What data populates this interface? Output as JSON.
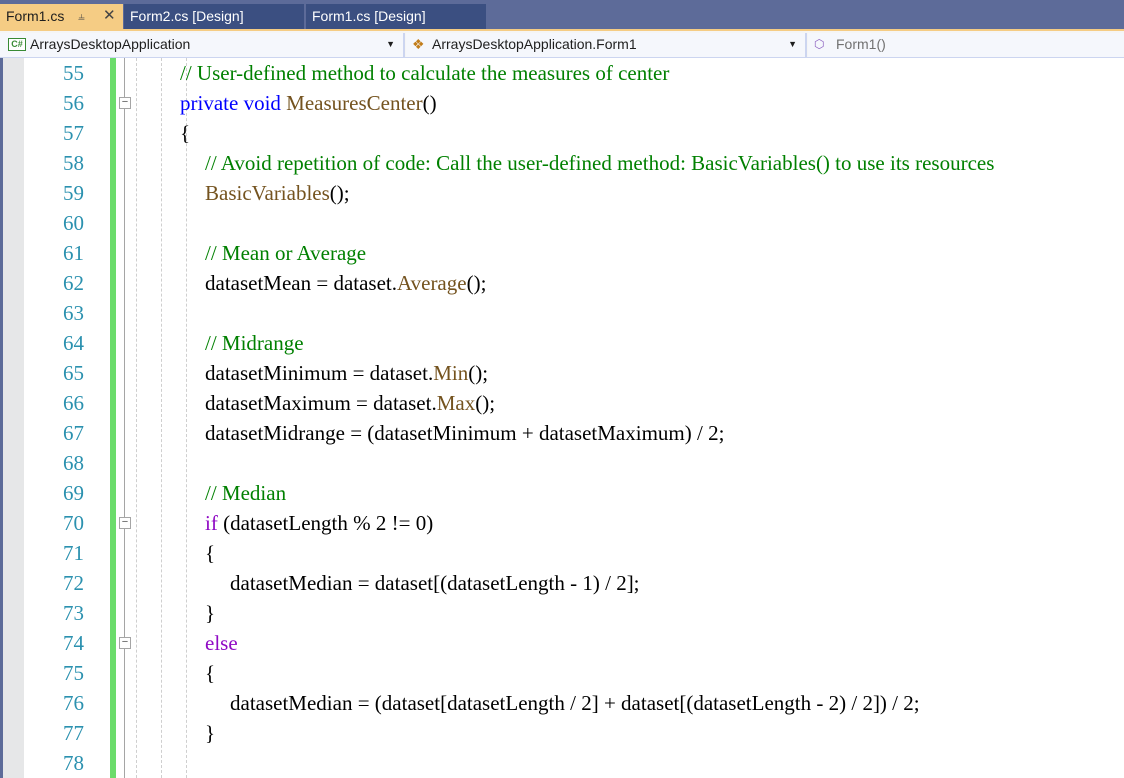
{
  "tabs": [
    {
      "label": "Form1.cs",
      "active": true,
      "pin_icon": "pin-icon",
      "close_icon": "close-icon"
    },
    {
      "label": "Form2.cs [Design]",
      "active": false
    },
    {
      "label": "Form1.cs [Design]",
      "active": false
    }
  ],
  "navbar": {
    "project": {
      "icon": "csharp-project-icon",
      "badge": "C#",
      "label": "ArraysDesktopApplication"
    },
    "type": {
      "icon": "class-icon",
      "label": "ArraysDesktopApplication.Form1"
    },
    "member": {
      "icon": "method-icon",
      "label": "Form1()"
    }
  },
  "colors": {
    "tab_bar": "#5d6b99",
    "active_tab": "#f5cc84",
    "line_number": "#2b91af",
    "keyword": "#0000ff",
    "control_keyword": "#8f08c4",
    "comment": "#008000",
    "method": "#74531f",
    "change_bar": "#6bdc6b"
  },
  "editor": {
    "lines": [
      {
        "num": "55",
        "indent": 0,
        "tokens": [
          {
            "t": "// User-defined method to calculate the measures of center",
            "c": "cm"
          }
        ]
      },
      {
        "num": "56",
        "indent": 0,
        "collapse": true,
        "tokens": [
          {
            "t": "private",
            "c": "kw"
          },
          {
            "t": " "
          },
          {
            "t": "void",
            "c": "kw"
          },
          {
            "t": " "
          },
          {
            "t": "MeasuresCenter",
            "c": "mt"
          },
          {
            "t": "()"
          }
        ]
      },
      {
        "num": "57",
        "indent": 0,
        "tokens": [
          {
            "t": "{"
          }
        ]
      },
      {
        "num": "58",
        "indent": 1,
        "tokens": [
          {
            "t": "// Avoid repetition of code: Call the user-defined method: BasicVariables() to use its resources",
            "c": "cm"
          }
        ]
      },
      {
        "num": "59",
        "indent": 1,
        "tokens": [
          {
            "t": "BasicVariables",
            "c": "mt"
          },
          {
            "t": "();"
          }
        ]
      },
      {
        "num": "60",
        "indent": 1,
        "tokens": []
      },
      {
        "num": "61",
        "indent": 1,
        "tokens": [
          {
            "t": "// Mean or Average",
            "c": "cm"
          }
        ]
      },
      {
        "num": "62",
        "indent": 1,
        "tokens": [
          {
            "t": "datasetMean = dataset."
          },
          {
            "t": "Average",
            "c": "mt"
          },
          {
            "t": "();"
          }
        ]
      },
      {
        "num": "63",
        "indent": 1,
        "tokens": []
      },
      {
        "num": "64",
        "indent": 1,
        "tokens": [
          {
            "t": "// Midrange",
            "c": "cm"
          }
        ]
      },
      {
        "num": "65",
        "indent": 1,
        "tokens": [
          {
            "t": "datasetMinimum = dataset."
          },
          {
            "t": "Min",
            "c": "mt"
          },
          {
            "t": "();"
          }
        ]
      },
      {
        "num": "66",
        "indent": 1,
        "tokens": [
          {
            "t": "datasetMaximum = dataset."
          },
          {
            "t": "Max",
            "c": "mt"
          },
          {
            "t": "();"
          }
        ]
      },
      {
        "num": "67",
        "indent": 1,
        "tokens": [
          {
            "t": "datasetMidrange = (datasetMinimum + datasetMaximum) / 2;"
          }
        ]
      },
      {
        "num": "68",
        "indent": 1,
        "tokens": []
      },
      {
        "num": "69",
        "indent": 1,
        "tokens": [
          {
            "t": "// Median",
            "c": "cm"
          }
        ]
      },
      {
        "num": "70",
        "indent": 1,
        "collapse": true,
        "tokens": [
          {
            "t": "if",
            "c": "ctl"
          },
          {
            "t": " (datasetLength % 2 != 0)"
          }
        ]
      },
      {
        "num": "71",
        "indent": 1,
        "tokens": [
          {
            "t": "{"
          }
        ]
      },
      {
        "num": "72",
        "indent": 2,
        "tokens": [
          {
            "t": "datasetMedian = dataset[(datasetLength - 1) / 2];"
          }
        ]
      },
      {
        "num": "73",
        "indent": 1,
        "tokens": [
          {
            "t": "}"
          }
        ]
      },
      {
        "num": "74",
        "indent": 1,
        "collapse": true,
        "tokens": [
          {
            "t": "else",
            "c": "ctl"
          }
        ]
      },
      {
        "num": "75",
        "indent": 1,
        "tokens": [
          {
            "t": "{"
          }
        ]
      },
      {
        "num": "76",
        "indent": 2,
        "tokens": [
          {
            "t": "datasetMedian = (dataset[datasetLength / 2] + dataset[(datasetLength - 2) / 2]) / 2;"
          }
        ]
      },
      {
        "num": "77",
        "indent": 1,
        "tokens": [
          {
            "t": "}"
          }
        ]
      },
      {
        "num": "78",
        "indent": 1,
        "tokens": []
      }
    ]
  }
}
